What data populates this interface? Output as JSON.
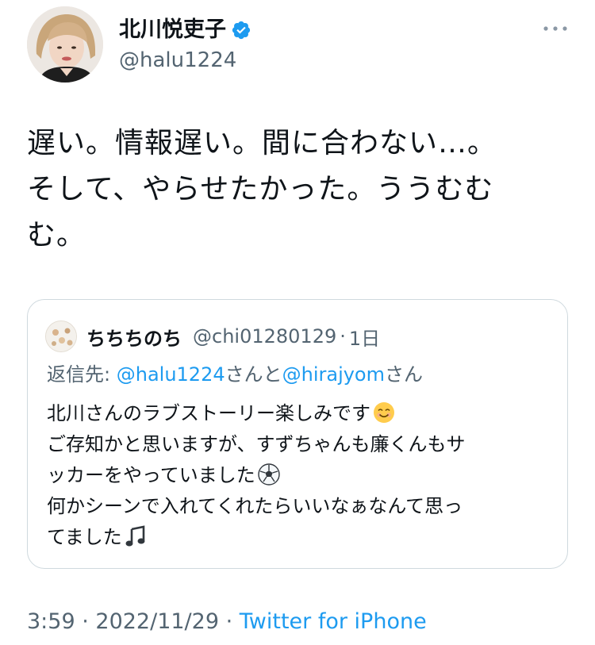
{
  "author": {
    "display_name": "北川悦吏子",
    "username": "@halu1224",
    "verified_icon": "verified-badge-icon",
    "more_icon": "more-options-icon"
  },
  "tweet": {
    "text": "遅い。情報遅い。間に合わない…。\nそして、やらせたかった。ううむむ\nむ。"
  },
  "quoted_tweet": {
    "display_name": "ちちちのち",
    "username": "@chi01280129",
    "separator": "·",
    "time": "1日",
    "reply_label": "返信先:",
    "reply_mention_1": "@halu1224",
    "reply_join": "さんと",
    "reply_mention_2": "@hirajyom",
    "reply_suffix": "さん",
    "body_lines": [
      "北川さんのラブストーリー楽しみです",
      "ご存知かと思いますが、すずちゃんも廉くんもサ",
      "ッカーをやっていました",
      "何かシーンで入れてくれたらいいなぁなんて思っ",
      "てました"
    ],
    "emoji_smile": "smiling-face-icon",
    "emoji_soccer": "soccer-ball-icon",
    "emoji_music": "musical-notes-icon"
  },
  "meta": {
    "time": "3:59",
    "separator_1": " · ",
    "date": "2022/11/29",
    "separator_2": " · ",
    "source": "Twitter for iPhone"
  },
  "colors": {
    "link": "#1d9bf0",
    "secondary_text": "#536471",
    "primary_text": "#0f1419",
    "border": "#cfd9de"
  }
}
